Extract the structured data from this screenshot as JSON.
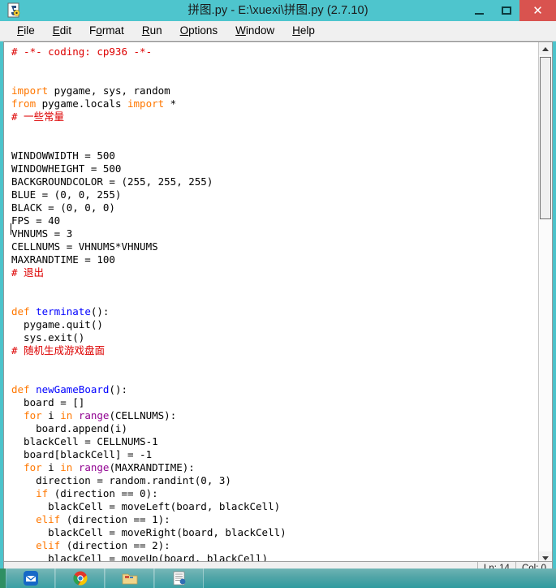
{
  "window": {
    "title": "拼图.py - E:\\xuexi\\拼图.py (2.7.10)",
    "icon_name": "python-idle-icon",
    "minimize_label": "",
    "maximize_label": "",
    "close_label": "✕"
  },
  "menubar": {
    "items": [
      {
        "label": "File",
        "accel": "F"
      },
      {
        "label": "Edit",
        "accel": "E"
      },
      {
        "label": "Format",
        "accel": "o"
      },
      {
        "label": "Run",
        "accel": "R"
      },
      {
        "label": "Options",
        "accel": "O"
      },
      {
        "label": "Window",
        "accel": "W"
      },
      {
        "label": "Help",
        "accel": "H"
      }
    ]
  },
  "editor": {
    "lines": [
      {
        "n": 1,
        "tokens": [
          {
            "t": "# -*- coding: cp936 -*-",
            "c": "com"
          }
        ]
      },
      {
        "n": 2,
        "tokens": []
      },
      {
        "n": 3,
        "tokens": []
      },
      {
        "n": 4,
        "tokens": [
          {
            "t": "import",
            "c": "kw"
          },
          {
            "t": " pygame, sys, random",
            "c": ""
          }
        ]
      },
      {
        "n": 5,
        "tokens": [
          {
            "t": "from",
            "c": "kw"
          },
          {
            "t": " pygame.locals ",
            "c": ""
          },
          {
            "t": "import",
            "c": "kw"
          },
          {
            "t": " *",
            "c": ""
          }
        ]
      },
      {
        "n": 6,
        "tokens": [
          {
            "t": "# 一些常量",
            "c": "com"
          }
        ]
      },
      {
        "n": 7,
        "tokens": []
      },
      {
        "n": 8,
        "tokens": []
      },
      {
        "n": 9,
        "tokens": [
          {
            "t": "WINDOWWIDTH = 500",
            "c": ""
          }
        ]
      },
      {
        "n": 10,
        "tokens": [
          {
            "t": "WINDOWHEIGHT = 500",
            "c": ""
          }
        ]
      },
      {
        "n": 11,
        "tokens": [
          {
            "t": "BACKGROUNDCOLOR = (255, 255, 255)",
            "c": ""
          }
        ]
      },
      {
        "n": 12,
        "tokens": [
          {
            "t": "BLUE = (0, 0, 255)",
            "c": ""
          }
        ]
      },
      {
        "n": 13,
        "tokens": [
          {
            "t": "BLACK = (0, 0, 0)",
            "c": ""
          }
        ]
      },
      {
        "n": 14,
        "tokens": [
          {
            "t": "FPS = 40",
            "c": "",
            "cursor_before": true
          }
        ]
      },
      {
        "n": 15,
        "tokens": [
          {
            "t": "VHNUMS = 3",
            "c": ""
          }
        ]
      },
      {
        "n": 16,
        "tokens": [
          {
            "t": "CELLNUMS = VHNUMS*VHNUMS",
            "c": ""
          }
        ]
      },
      {
        "n": 17,
        "tokens": [
          {
            "t": "MAXRANDTIME = 100",
            "c": ""
          }
        ]
      },
      {
        "n": 18,
        "tokens": [
          {
            "t": "# 退出",
            "c": "com"
          }
        ]
      },
      {
        "n": 19,
        "tokens": []
      },
      {
        "n": 20,
        "tokens": []
      },
      {
        "n": 21,
        "tokens": [
          {
            "t": "def",
            "c": "kw"
          },
          {
            "t": " ",
            "c": ""
          },
          {
            "t": "terminate",
            "c": "fn"
          },
          {
            "t": "():",
            "c": ""
          }
        ]
      },
      {
        "n": 22,
        "tokens": [
          {
            "t": "  pygame.quit()",
            "c": ""
          }
        ]
      },
      {
        "n": 23,
        "tokens": [
          {
            "t": "  sys.exit()",
            "c": ""
          }
        ]
      },
      {
        "n": 24,
        "tokens": [
          {
            "t": "# 随机生成游戏盘面",
            "c": "com"
          }
        ]
      },
      {
        "n": 25,
        "tokens": []
      },
      {
        "n": 26,
        "tokens": []
      },
      {
        "n": 27,
        "tokens": [
          {
            "t": "def",
            "c": "kw"
          },
          {
            "t": " ",
            "c": ""
          },
          {
            "t": "newGameBoard",
            "c": "fn"
          },
          {
            "t": "():",
            "c": ""
          }
        ]
      },
      {
        "n": 28,
        "tokens": [
          {
            "t": "  board = []",
            "c": ""
          }
        ]
      },
      {
        "n": 29,
        "tokens": [
          {
            "t": "  ",
            "c": ""
          },
          {
            "t": "for",
            "c": "kw"
          },
          {
            "t": " i ",
            "c": ""
          },
          {
            "t": "in",
            "c": "kw"
          },
          {
            "t": " ",
            "c": ""
          },
          {
            "t": "range",
            "c": "bi"
          },
          {
            "t": "(CELLNUMS):",
            "c": ""
          }
        ]
      },
      {
        "n": 30,
        "tokens": [
          {
            "t": "    board.append(i)",
            "c": ""
          }
        ]
      },
      {
        "n": 31,
        "tokens": [
          {
            "t": "  blackCell = CELLNUMS-1",
            "c": ""
          }
        ]
      },
      {
        "n": 32,
        "tokens": [
          {
            "t": "  board[blackCell] = -1",
            "c": ""
          }
        ]
      },
      {
        "n": 33,
        "tokens": [
          {
            "t": "  ",
            "c": ""
          },
          {
            "t": "for",
            "c": "kw"
          },
          {
            "t": " i ",
            "c": ""
          },
          {
            "t": "in",
            "c": "kw"
          },
          {
            "t": " ",
            "c": ""
          },
          {
            "t": "range",
            "c": "bi"
          },
          {
            "t": "(MAXRANDTIME):",
            "c": ""
          }
        ]
      },
      {
        "n": 34,
        "tokens": [
          {
            "t": "    direction = random.randint(0, 3)",
            "c": ""
          }
        ]
      },
      {
        "n": 35,
        "tokens": [
          {
            "t": "    ",
            "c": ""
          },
          {
            "t": "if",
            "c": "kw"
          },
          {
            "t": " (direction == 0):",
            "c": ""
          }
        ]
      },
      {
        "n": 36,
        "tokens": [
          {
            "t": "      blackCell = moveLeft(board, blackCell)",
            "c": ""
          }
        ]
      },
      {
        "n": 37,
        "tokens": [
          {
            "t": "    ",
            "c": ""
          },
          {
            "t": "elif",
            "c": "kw"
          },
          {
            "t": " (direction == 1):",
            "c": ""
          }
        ]
      },
      {
        "n": 38,
        "tokens": [
          {
            "t": "      blackCell = moveRight(board, blackCell)",
            "c": ""
          }
        ]
      },
      {
        "n": 39,
        "tokens": [
          {
            "t": "    ",
            "c": ""
          },
          {
            "t": "elif",
            "c": "kw"
          },
          {
            "t": " (direction == 2):",
            "c": ""
          }
        ]
      },
      {
        "n": 40,
        "tokens": [
          {
            "t": "      blackCell = moveUp(board, blackCell)",
            "c": ""
          }
        ]
      }
    ],
    "colors": {
      "keyword": "#ff7700",
      "comment": "#dd0000",
      "definition": "#0000ff",
      "builtin": "#900090",
      "text": "#000000",
      "background": "#ffffff"
    }
  },
  "scrollbar": {
    "up_arrow_name": "scroll-up-arrow",
    "down_arrow_name": "scroll-down-arrow"
  },
  "statusbar": {
    "line_label": "Ln: 14",
    "col_label": "Col: 0"
  },
  "taskbar": {
    "buttons": [
      {
        "name": "taskbar-mail-app",
        "icon": "mail-icon"
      },
      {
        "name": "taskbar-chrome",
        "icon": "chrome-icon"
      },
      {
        "name": "taskbar-folder",
        "icon": "folder-icon"
      },
      {
        "name": "taskbar-document",
        "icon": "document-icon"
      }
    ]
  },
  "theme": {
    "titlebar_bg": "#4ec5cd",
    "close_bg": "#d9534f",
    "menubar_bg": "#f0f0f0",
    "desktop_bg": "#4cc3cb"
  }
}
